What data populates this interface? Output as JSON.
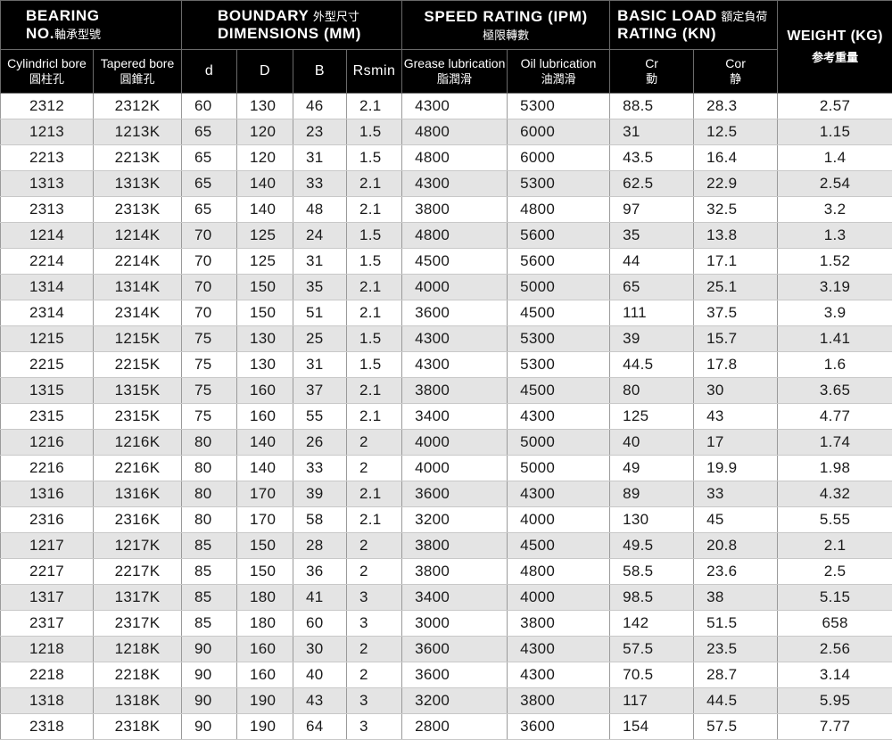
{
  "header": {
    "bearing_en1": "BEARING",
    "bearing_en2": "NO.",
    "bearing_zh": "軸承型號",
    "boundary_en1": "BOUNDARY",
    "boundary_zh": "外型尺寸",
    "boundary_en2": "DIMENSIONS (MM)",
    "speed_en": "SPEED RATING (IPM)",
    "speed_zh": "極限轉數",
    "load_en1": "BASIC LOAD",
    "load_zh": "額定負荷",
    "load_en2": "RATING (KN)",
    "weight_en": "WEIGHT (KG)",
    "weight_zh": "参考重量",
    "cyl_en": "Cylindricl bore",
    "cyl_zh": "圓柱孔",
    "tap_en": "Tapered bore",
    "tap_zh": "圓錐孔",
    "d": "d",
    "D": "D",
    "B": "B",
    "rsmin": "Rsmin",
    "grease_en": "Grease lubrication",
    "grease_zh": "脂潤滑",
    "oil_en": "Oil lubrication",
    "oil_zh": "油潤滑",
    "cr_en": "Cr",
    "cr_zh": "動",
    "cor_en": "Cor",
    "cor_zh": "静"
  },
  "rows": [
    [
      "2312",
      "2312K",
      "60",
      "130",
      "46",
      "2.1",
      "4300",
      "5300",
      "88.5",
      "28.3",
      "2.57"
    ],
    [
      "1213",
      "1213K",
      "65",
      "120",
      "23",
      "1.5",
      "4800",
      "6000",
      "31",
      "12.5",
      "1.15"
    ],
    [
      "2213",
      "2213K",
      "65",
      "120",
      "31",
      "1.5",
      "4800",
      "6000",
      "43.5",
      "16.4",
      "1.4"
    ],
    [
      "1313",
      "1313K",
      "65",
      "140",
      "33",
      "2.1",
      "4300",
      "5300",
      "62.5",
      "22.9",
      "2.54"
    ],
    [
      "2313",
      "2313K",
      "65",
      "140",
      "48",
      "2.1",
      "3800",
      "4800",
      "97",
      "32.5",
      "3.2"
    ],
    [
      "1214",
      "1214K",
      "70",
      "125",
      "24",
      "1.5",
      "4800",
      "5600",
      "35",
      "13.8",
      "1.3"
    ],
    [
      "2214",
      "2214K",
      "70",
      "125",
      "31",
      "1.5",
      "4500",
      "5600",
      "44",
      "17.1",
      "1.52"
    ],
    [
      "1314",
      "1314K",
      "70",
      "150",
      "35",
      "2.1",
      "4000",
      "5000",
      "65",
      "25.1",
      "3.19"
    ],
    [
      "2314",
      "2314K",
      "70",
      "150",
      "51",
      "2.1",
      "3600",
      "4500",
      "111",
      "37.5",
      "3.9"
    ],
    [
      "1215",
      "1215K",
      "75",
      "130",
      "25",
      "1.5",
      "4300",
      "5300",
      "39",
      "15.7",
      "1.41"
    ],
    [
      "2215",
      "2215K",
      "75",
      "130",
      "31",
      "1.5",
      "4300",
      "5300",
      "44.5",
      "17.8",
      "1.6"
    ],
    [
      "1315",
      "1315K",
      "75",
      "160",
      "37",
      "2.1",
      "3800",
      "4500",
      "80",
      "30",
      "3.65"
    ],
    [
      "2315",
      "2315K",
      "75",
      "160",
      "55",
      "2.1",
      "3400",
      "4300",
      "125",
      "43",
      "4.77"
    ],
    [
      "1216",
      "1216K",
      "80",
      "140",
      "26",
      "2",
      "4000",
      "5000",
      "40",
      "17",
      "1.74"
    ],
    [
      "2216",
      "2216K",
      "80",
      "140",
      "33",
      "2",
      "4000",
      "5000",
      "49",
      "19.9",
      "1.98"
    ],
    [
      "1316",
      "1316K",
      "80",
      "170",
      "39",
      "2.1",
      "3600",
      "4300",
      "89",
      "33",
      "4.32"
    ],
    [
      "2316",
      "2316K",
      "80",
      "170",
      "58",
      "2.1",
      "3200",
      "4000",
      "130",
      "45",
      "5.55"
    ],
    [
      "1217",
      "1217K",
      "85",
      "150",
      "28",
      "2",
      "3800",
      "4500",
      "49.5",
      "20.8",
      "2.1"
    ],
    [
      "2217",
      "2217K",
      "85",
      "150",
      "36",
      "2",
      "3800",
      "4800",
      "58.5",
      "23.6",
      "2.5"
    ],
    [
      "1317",
      "1317K",
      "85",
      "180",
      "41",
      "3",
      "3400",
      "4000",
      "98.5",
      "38",
      "5.15"
    ],
    [
      "2317",
      "2317K",
      "85",
      "180",
      "60",
      "3",
      "3000",
      "3800",
      "142",
      "51.5",
      "658"
    ],
    [
      "1218",
      "1218K",
      "90",
      "160",
      "30",
      "2",
      "3600",
      "4300",
      "57.5",
      "23.5",
      "2.56"
    ],
    [
      "2218",
      "2218K",
      "90",
      "160",
      "40",
      "2",
      "3600",
      "4300",
      "70.5",
      "28.7",
      "3.14"
    ],
    [
      "1318",
      "1318K",
      "90",
      "190",
      "43",
      "3",
      "3200",
      "3800",
      "117",
      "44.5",
      "5.95"
    ],
    [
      "2318",
      "2318K",
      "90",
      "190",
      "64",
      "3",
      "2800",
      "3600",
      "154",
      "57.5",
      "7.77"
    ]
  ]
}
